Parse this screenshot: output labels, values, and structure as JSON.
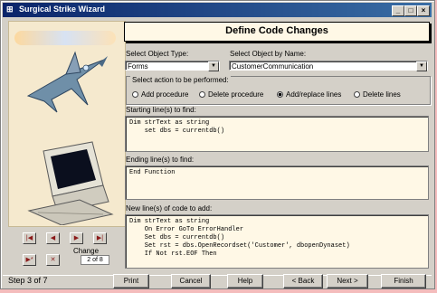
{
  "window": {
    "title": "Surgical Strike Wizard"
  },
  "titlebar_buttons": {
    "min": "_",
    "max": "□",
    "close": "×"
  },
  "header": {
    "title": "Define Code Changes"
  },
  "object_type": {
    "label": "Select Object Type:",
    "value": "Forms"
  },
  "object_name": {
    "label": "Select Object by Name:",
    "value": "CustomerCommunication"
  },
  "action_group": {
    "label": "Select action to be performed:",
    "options": [
      "Add procedure",
      "Delete procedure",
      "Add/replace lines",
      "Delete lines"
    ],
    "selected": 2
  },
  "starting": {
    "label": "Starting line(s) to find:",
    "code": "Dim strText as string\n    set dbs = currentdb()"
  },
  "ending": {
    "label": "Ending line(s) to find:",
    "code": "End Function"
  },
  "newlines": {
    "label": "New line(s) of code to add:",
    "code": "Dim strText as string\n    On Error GoTo ErrorHandler\n    Set dbs = currentdb()\n    Set rst = dbs.OpenRecordset('Customer', dbopenDynaset)\n    If Not rst.EOF Then"
  },
  "nav": {
    "first": "|◀",
    "prev": "◀",
    "next": "▶",
    "last": "▶|",
    "new": "▶*",
    "delete": "✕",
    "change_label": "Change",
    "change_value": "2 of 8"
  },
  "footer": {
    "step": "Step 3 of 7",
    "print": "Print",
    "cancel": "Cancel",
    "help": "Help",
    "back": "< Back",
    "next": "Next >",
    "finish": "Finish"
  }
}
